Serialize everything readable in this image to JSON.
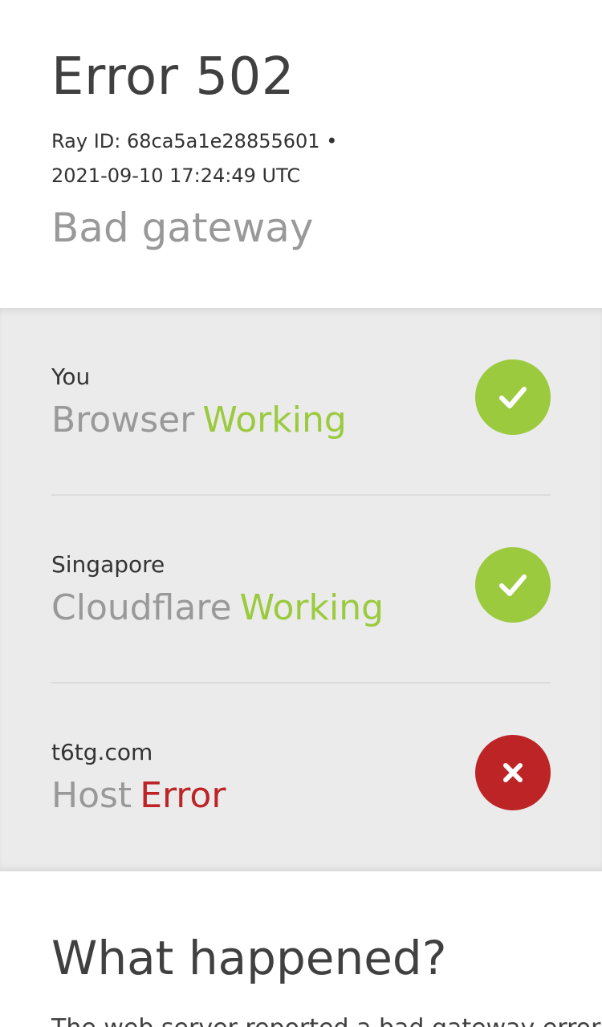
{
  "header": {
    "title": "Error 502",
    "ray_id_line": "Ray ID: 68ca5a1e28855601 •",
    "timestamp_line": "2021-09-10 17:24:49 UTC",
    "subtitle": "Bad gateway"
  },
  "status": [
    {
      "location": "You",
      "service": "Browser",
      "state": "Working",
      "result": "ok",
      "icon": "check-icon"
    },
    {
      "location": "Singapore",
      "service": "Cloudflare",
      "state": "Working",
      "result": "ok",
      "icon": "check-icon"
    },
    {
      "location": "t6tg.com",
      "service": "Host",
      "state": "Error",
      "result": "error",
      "icon": "close-icon"
    }
  ],
  "what_happened": {
    "title": "What happened?",
    "body_start": "The web server reported a bad gateway error."
  },
  "colors": {
    "working": "#9bca3e",
    "error": "#bd2426",
    "panel_bg": "#ebebeb"
  }
}
